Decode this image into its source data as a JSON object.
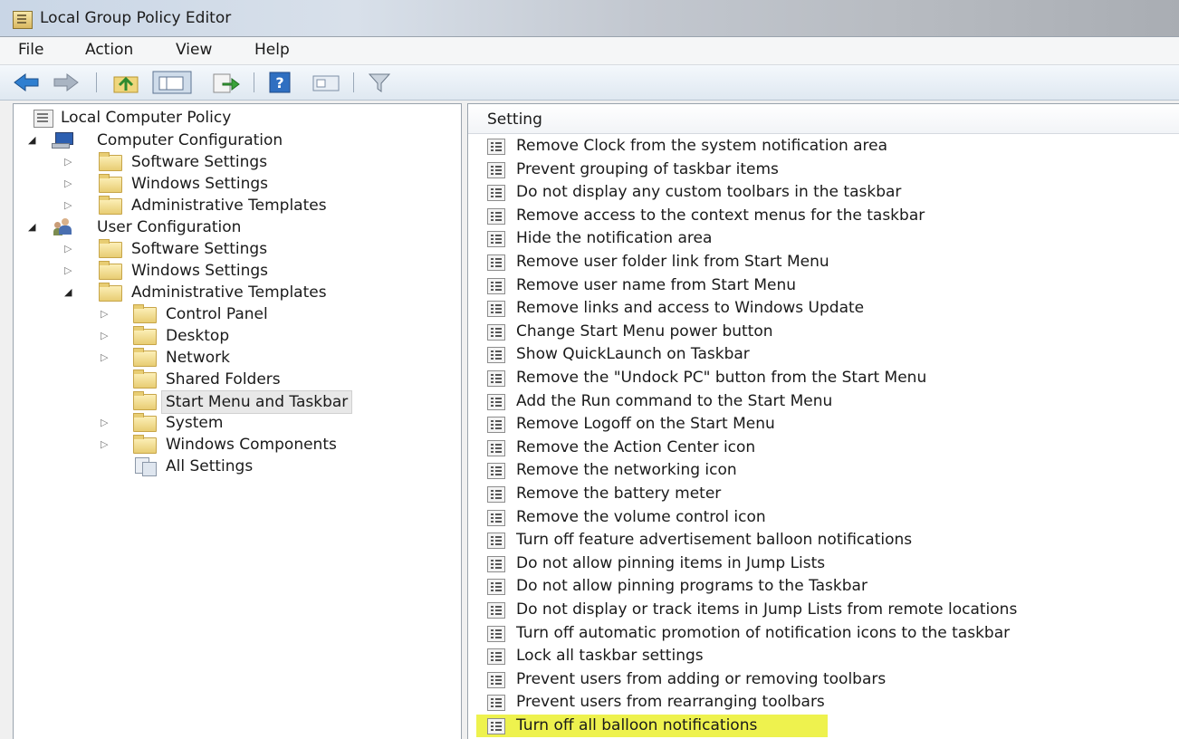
{
  "window": {
    "title": "Local Group Policy Editor",
    "icon": "policy-editor-icon"
  },
  "menu": [
    "File",
    "Action",
    "View",
    "Help"
  ],
  "toolbar": {
    "buttons": [
      "back-arrow-icon",
      "forward-arrow-icon",
      "up-folder-icon",
      "show-hide-tree-icon",
      "export-list-icon",
      "help-icon",
      "properties-view-icon",
      "filter-icon"
    ]
  },
  "tree": {
    "root": "Local Computer Policy",
    "computer_config": "Computer Configuration",
    "cc_software": "Software Settings",
    "cc_windows": "Windows Settings",
    "cc_admin": "Administrative Templates",
    "user_config": "User Configuration",
    "uc_software": "Software Settings",
    "uc_windows": "Windows Settings",
    "uc_admin": "Administrative Templates",
    "control_panel": "Control Panel",
    "desktop": "Desktop",
    "network": "Network",
    "shared_folders": "Shared Folders",
    "start_menu": "Start Menu and Taskbar",
    "system": "System",
    "windows_components": "Windows Components",
    "all_settings": "All Settings"
  },
  "list": {
    "header": "Setting",
    "items": [
      "Remove Clock from the system notification area",
      "Prevent grouping of taskbar items",
      "Do not display any custom toolbars in the taskbar",
      "Remove access to the context menus for the taskbar",
      "Hide the notification area",
      "Remove user folder link from Start Menu",
      "Remove user name from Start Menu",
      "Remove links and access to Windows Update",
      "Change Start Menu power button",
      "Show QuickLaunch on Taskbar",
      "Remove the \"Undock PC\" button from the Start Menu",
      "Add the Run command to the Start Menu",
      "Remove Logoff on the Start Menu",
      "Remove the Action Center icon",
      "Remove the networking icon",
      "Remove the battery meter",
      "Remove the volume control icon",
      "Turn off feature advertisement balloon notifications",
      "Do not allow pinning items in Jump Lists",
      "Do not allow pinning programs to the Taskbar",
      "Do not display or track items in Jump Lists from remote locations",
      "Turn off automatic promotion of notification icons to the taskbar",
      "Lock all taskbar settings",
      "Prevent users from adding or removing toolbars",
      "Prevent users from rearranging toolbars",
      "Turn off all balloon notifications"
    ],
    "highlight_color": "#eef24e"
  }
}
